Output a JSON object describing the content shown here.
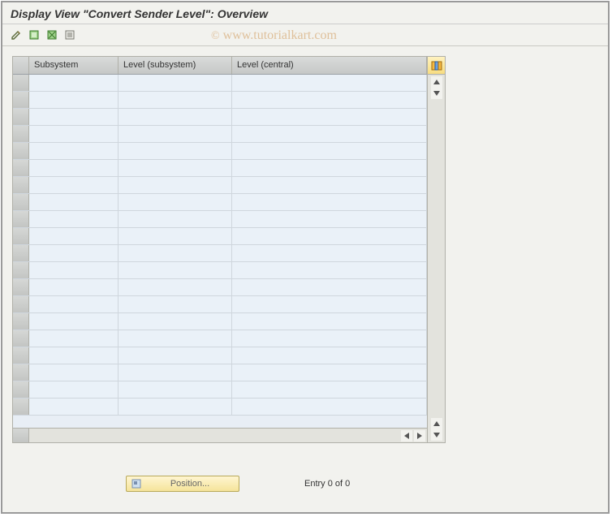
{
  "window": {
    "title": "Display View \"Convert Sender Level\": Overview"
  },
  "toolbar": {
    "buttons": [
      "change",
      "select-all",
      "deselect-all",
      "print"
    ]
  },
  "grid": {
    "columns": [
      {
        "label": "Subsystem"
      },
      {
        "label": "Level (subsystem)"
      },
      {
        "label": "Level (central)"
      }
    ],
    "rows": [
      {
        "c1": "",
        "c2": "",
        "c3": ""
      },
      {
        "c1": "",
        "c2": "",
        "c3": ""
      },
      {
        "c1": "",
        "c2": "",
        "c3": ""
      },
      {
        "c1": "",
        "c2": "",
        "c3": ""
      },
      {
        "c1": "",
        "c2": "",
        "c3": ""
      },
      {
        "c1": "",
        "c2": "",
        "c3": ""
      },
      {
        "c1": "",
        "c2": "",
        "c3": ""
      },
      {
        "c1": "",
        "c2": "",
        "c3": ""
      },
      {
        "c1": "",
        "c2": "",
        "c3": ""
      },
      {
        "c1": "",
        "c2": "",
        "c3": ""
      },
      {
        "c1": "",
        "c2": "",
        "c3": ""
      },
      {
        "c1": "",
        "c2": "",
        "c3": ""
      },
      {
        "c1": "",
        "c2": "",
        "c3": ""
      },
      {
        "c1": "",
        "c2": "",
        "c3": ""
      },
      {
        "c1": "",
        "c2": "",
        "c3": ""
      },
      {
        "c1": "",
        "c2": "",
        "c3": ""
      },
      {
        "c1": "",
        "c2": "",
        "c3": ""
      },
      {
        "c1": "",
        "c2": "",
        "c3": ""
      },
      {
        "c1": "",
        "c2": "",
        "c3": ""
      },
      {
        "c1": "",
        "c2": "",
        "c3": ""
      }
    ]
  },
  "footer": {
    "position_label": "Position...",
    "entry_text": "Entry 0 of 0"
  },
  "watermark": {
    "copyright": "©",
    "text": "www.tutorialkart.com"
  }
}
